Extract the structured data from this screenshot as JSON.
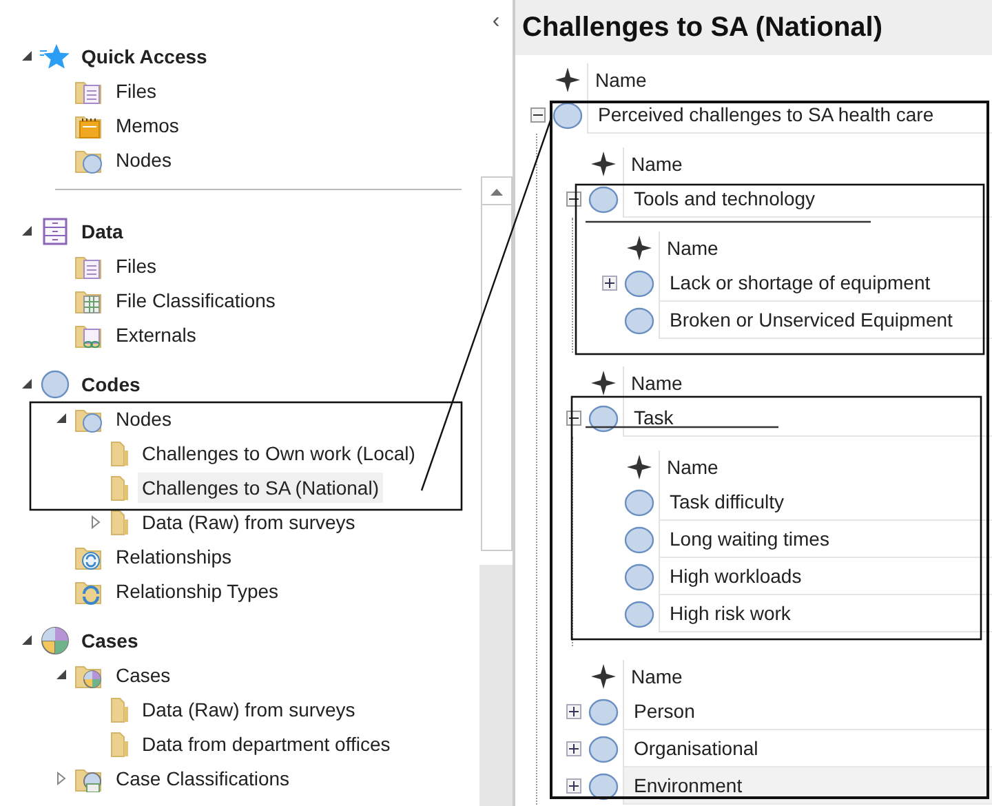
{
  "navigation": {
    "collapse_glyph": "‹",
    "sections": [
      {
        "label": "Quick Access",
        "kind": "star",
        "expandable": true,
        "expanded": true,
        "selected": false,
        "children": [
          {
            "label": "Files",
            "kind": "files",
            "expandable": false,
            "expanded": false,
            "selected": false
          },
          {
            "label": "Memos",
            "kind": "memos",
            "expandable": false,
            "expanded": false,
            "selected": false
          },
          {
            "label": "Nodes",
            "kind": "nodes",
            "expandable": false,
            "expanded": false,
            "selected": false
          }
        ]
      },
      {
        "label": "Data",
        "kind": "data",
        "expandable": true,
        "expanded": true,
        "selected": false,
        "children": [
          {
            "label": "Files",
            "kind": "files",
            "expandable": false,
            "expanded": false,
            "selected": false
          },
          {
            "label": "File Classifications",
            "kind": "classifications",
            "expandable": false,
            "expanded": false,
            "selected": false
          },
          {
            "label": "Externals",
            "kind": "externals",
            "expandable": false,
            "expanded": false,
            "selected": false
          }
        ]
      },
      {
        "label": "Codes",
        "kind": "codes",
        "expandable": true,
        "expanded": true,
        "selected": false,
        "children": [
          {
            "label": "Nodes",
            "kind": "nodes",
            "expandable": true,
            "expanded": true,
            "selected": false,
            "children": [
              {
                "label": "Challenges to Own work (Local)",
                "kind": "folder",
                "expandable": false,
                "expanded": false,
                "selected": false
              },
              {
                "label": "Challenges to SA (National)",
                "kind": "folder",
                "expandable": false,
                "expanded": false,
                "selected": true
              },
              {
                "label": "Data (Raw) from surveys",
                "kind": "folder",
                "expandable": true,
                "expanded": false,
                "selected": false
              }
            ]
          },
          {
            "label": "Relationships",
            "kind": "relationships",
            "expandable": false,
            "expanded": false,
            "selected": false
          },
          {
            "label": "Relationship Types",
            "kind": "reltypes",
            "expandable": false,
            "expanded": false,
            "selected": false
          }
        ]
      },
      {
        "label": "Cases",
        "kind": "cases",
        "expandable": true,
        "expanded": true,
        "selected": false,
        "children": [
          {
            "label": "Cases",
            "kind": "casesfolder",
            "expandable": true,
            "expanded": true,
            "selected": false,
            "children": [
              {
                "label": "Data (Raw) from surveys",
                "kind": "folder",
                "expandable": false,
                "expanded": false,
                "selected": false
              },
              {
                "label": "Data from department offices",
                "kind": "folder",
                "expandable": false,
                "expanded": false,
                "selected": false
              }
            ]
          },
          {
            "label": "Case Classifications",
            "kind": "caseclass",
            "expandable": true,
            "expanded": false,
            "selected": false
          }
        ]
      }
    ]
  },
  "detail": {
    "title": "Challenges to SA (National)",
    "groups": [
      {
        "header": "Name",
        "rows": [
          {
            "label": "Perceived challenges to SA health care",
            "expandable": true,
            "expanded": true,
            "selected": false,
            "groups": [
              {
                "header": "Name",
                "rows": [
                  {
                    "label": "Tools and technology",
                    "expandable": true,
                    "expanded": true,
                    "selected": false,
                    "groups": [
                      {
                        "header": "Name",
                        "rows": [
                          {
                            "label": "Lack or shortage of equipment",
                            "expandable": true,
                            "expanded": false,
                            "selected": false
                          },
                          {
                            "label": "Broken or Unserviced Equipment",
                            "expandable": false,
                            "expanded": false,
                            "selected": false
                          }
                        ]
                      }
                    ]
                  }
                ]
              },
              {
                "header": "Name",
                "rows": [
                  {
                    "label": "Task",
                    "expandable": true,
                    "expanded": true,
                    "selected": false,
                    "groups": [
                      {
                        "header": "Name",
                        "rows": [
                          {
                            "label": "Task difficulty",
                            "expandable": false,
                            "expanded": false,
                            "selected": false
                          },
                          {
                            "label": "Long waiting times",
                            "expandable": false,
                            "expanded": false,
                            "selected": false
                          },
                          {
                            "label": "High workloads",
                            "expandable": false,
                            "expanded": false,
                            "selected": false
                          },
                          {
                            "label": "High risk work",
                            "expandable": false,
                            "expanded": false,
                            "selected": false
                          }
                        ]
                      }
                    ]
                  }
                ]
              },
              {
                "header": "Name",
                "rows": [
                  {
                    "label": "Person",
                    "expandable": true,
                    "expanded": false,
                    "selected": false
                  },
                  {
                    "label": "Organisational",
                    "expandable": true,
                    "expanded": false,
                    "selected": false
                  },
                  {
                    "label": "Environment",
                    "expandable": true,
                    "expanded": false,
                    "selected": true
                  }
                ]
              }
            ]
          }
        ]
      }
    ]
  }
}
